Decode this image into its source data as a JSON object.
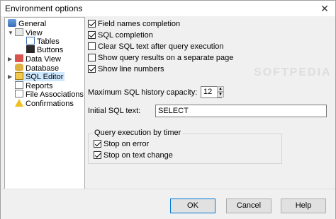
{
  "window": {
    "title": "Environment options",
    "close_glyph": "✕"
  },
  "tree": {
    "items": [
      {
        "label": "General",
        "icon": "general-icon"
      },
      {
        "label": "View",
        "icon": "view-icon",
        "expanded": true
      },
      {
        "label": "Tables",
        "icon": "tables-icon"
      },
      {
        "label": "Buttons",
        "icon": "buttons-icon"
      },
      {
        "label": "Data View",
        "icon": "data-view-icon"
      },
      {
        "label": "Database",
        "icon": "database-icon"
      },
      {
        "label": "SQL Editor",
        "icon": "sql-editor-icon",
        "selected": true
      },
      {
        "label": "Reports",
        "icon": "reports-icon"
      },
      {
        "label": "File Associations",
        "icon": "file-associations-icon"
      },
      {
        "label": "Confirmations",
        "icon": "warning-icon"
      }
    ]
  },
  "options": {
    "field_names": {
      "label": "Field names completion",
      "checked": true
    },
    "sql_completion": {
      "label": "SQL completion",
      "checked": true
    },
    "clear_sql": {
      "label": "Clear SQL text after query execution",
      "checked": false
    },
    "separate_page": {
      "label": "Show query results on a separate page",
      "checked": false
    },
    "line_numbers": {
      "label": "Show line numbers",
      "checked": true
    }
  },
  "history": {
    "label": "Maximum SQL history capacity:",
    "value": "12"
  },
  "initial_sql": {
    "label": "Initial SQL text:",
    "value": "SELECT"
  },
  "timer_group": {
    "title": "Query execution by timer",
    "stop_on_error": {
      "label": "Stop on error",
      "checked": true
    },
    "stop_on_text_change": {
      "label": "Stop on text change",
      "checked": true
    }
  },
  "buttons": {
    "ok": "OK",
    "cancel": "Cancel",
    "help": "Help"
  },
  "watermark": "SOFTPEDIA",
  "colors": {
    "selection": "#cde8ff",
    "accent": "#0078d7"
  }
}
